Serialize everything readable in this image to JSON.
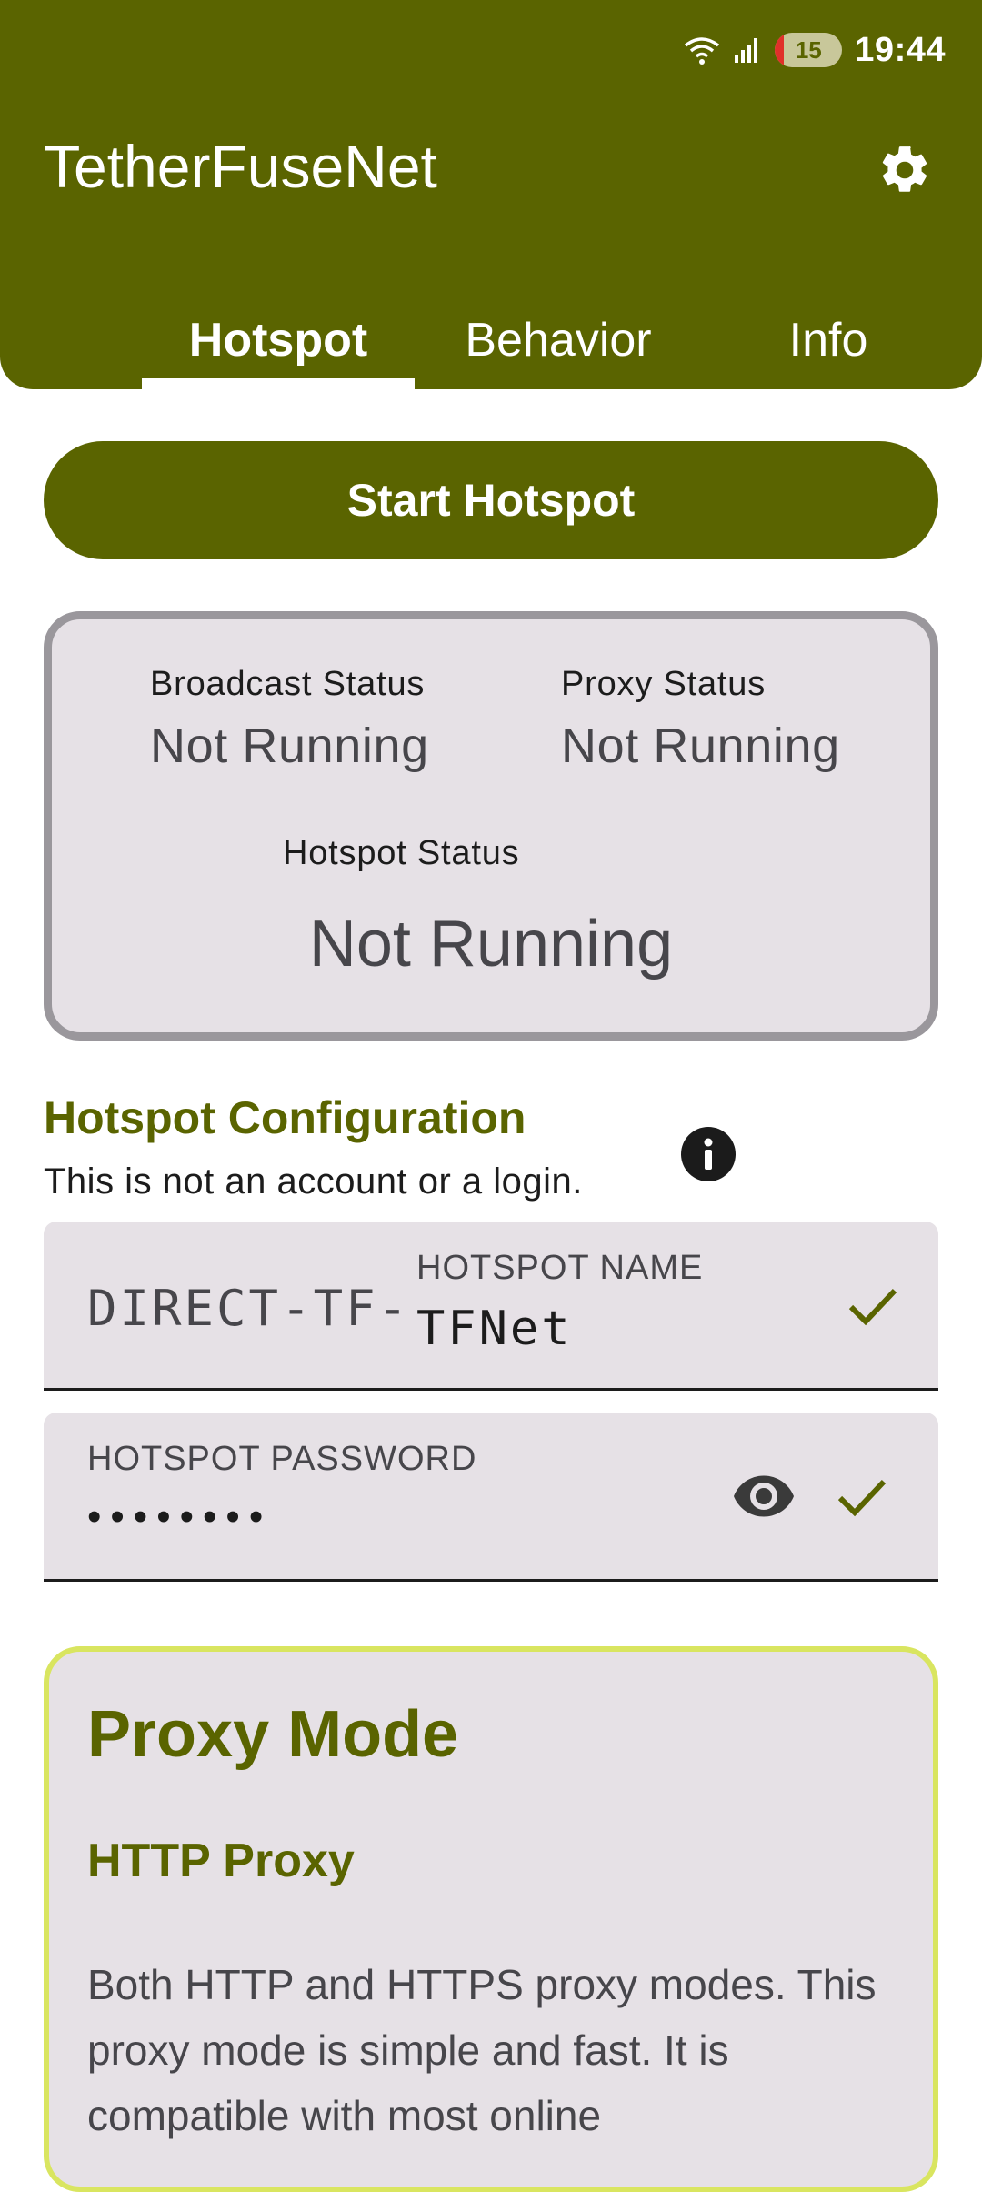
{
  "status_bar": {
    "time": "19:44",
    "battery_level": "15"
  },
  "app": {
    "title": "TetherFuseNet"
  },
  "tabs": [
    {
      "label": "Hotspot",
      "active": true
    },
    {
      "label": "Behavior",
      "active": false
    },
    {
      "label": "Info",
      "active": false
    }
  ],
  "primary_action": {
    "label": "Start Hotspot"
  },
  "status_card": {
    "broadcast_label": "Broadcast Status",
    "broadcast_value": "Not Running",
    "proxy_label": "Proxy Status",
    "proxy_value": "Not Running",
    "hotspot_label": "Hotspot Status",
    "hotspot_value": "Not Running"
  },
  "config": {
    "title": "Hotspot Configuration",
    "subtitle": "This is not an account or a login.",
    "name_prefix": "DIRECT-TF-",
    "name_label": "HOTSPOT NAME",
    "name_value": "TFNet",
    "password_label": "HOTSPOT PASSWORD",
    "password_masked": "••••••••"
  },
  "proxy": {
    "title": "Proxy Mode",
    "mode": "HTTP Proxy",
    "description": "Both HTTP and HTTPS proxy modes. This proxy mode is simple and fast. It is compatible with most online"
  },
  "colors": {
    "primary": "#5a6400",
    "surface": "#e6e1e6",
    "outline": "#9a979c",
    "highlight_border": "#d9e560"
  }
}
